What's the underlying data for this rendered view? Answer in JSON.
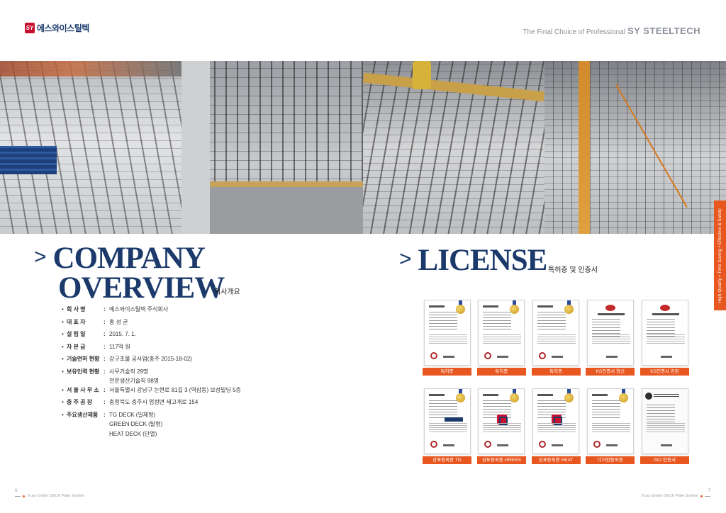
{
  "header": {
    "logo_mark": "SY",
    "logo_text": "에스와이스틸텍",
    "tagline": "The Final Choice of Professional",
    "brand": "SY STEELTECH"
  },
  "side_tab": "High-Quality • Time Saving • Effective & Safety",
  "company": {
    "arrow": ">",
    "title_line1": "COMPANY",
    "title_line2": "OVERVIEW",
    "subtitle": "회사개요",
    "items": [
      {
        "label": "회  사  명",
        "values": [
          "에스와이스틸텍 주식회사"
        ]
      },
      {
        "label": "대  표  자",
        "values": [
          "홍 성 균"
        ]
      },
      {
        "label": "설  립  일",
        "values": [
          "2015. 7. 1."
        ]
      },
      {
        "label": "자  본  금",
        "values": [
          "117억 원"
        ]
      },
      {
        "label": "기술면허 현황",
        "values": [
          "강구조물 공사업(충주 2015-18-02)"
        ]
      },
      {
        "label": "보유인력 현황",
        "values": [
          "사무기술직 29명",
          "전문생산기술직 98명"
        ]
      },
      {
        "label": "서 울 사 무 소",
        "values": [
          "서울특별시 강남구 논현로 81길 3 (역삼동) 보성빌딩 5층"
        ]
      },
      {
        "label": "충  주  공  장",
        "values": [
          "충청북도 충주시 엄정면 세고개로 154"
        ]
      },
      {
        "label": "주요생산제품",
        "values": [
          "TG DECK (일체형)",
          "GREEN DECK (탈형)",
          "HEAT DECK (단열)"
        ]
      }
    ]
  },
  "license": {
    "arrow": ">",
    "title": "LICENSE",
    "subtitle": "특허증 및 인증서",
    "row1": [
      "특허증",
      "특허증",
      "특허증",
      "KS인증서 청신",
      "KS인증서 강판"
    ],
    "row2": [
      "상표등록증 TG",
      "상표등록증 GREEN",
      "상표등록증 HEAT",
      "디자인등록증",
      "ISO 인증서"
    ]
  },
  "footer": {
    "page_left": "6",
    "page_right": "7",
    "caption_left": "Truss Girder DECK Plate System",
    "caption_right": "Truss Girder DECK Plate System"
  },
  "colors": {
    "navy": "#1b3a6b",
    "orange": "#e8571f",
    "gray_text": "#8a8f99"
  }
}
